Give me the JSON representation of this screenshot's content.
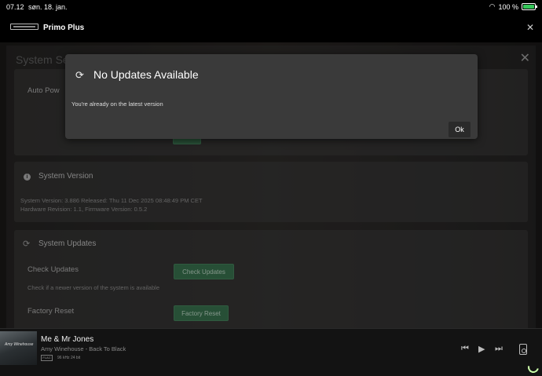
{
  "status_bar": {
    "time": "07.12",
    "date": "søn. 18. jan.",
    "battery": "100 %"
  },
  "app": {
    "title": "Primo Plus"
  },
  "page": {
    "title": "System Se",
    "auto_power_label": "Auto Pow",
    "version_card": {
      "title": "System Version",
      "line1": "System Version: 3.886 Released: Thu 11 Dec 2025 08:48:49 PM CET",
      "line2": "Hardware Revision: 1.1, Firmware Version: 0.5.2"
    },
    "updates_card": {
      "title": "System Updates",
      "check_label": "Check Updates",
      "check_desc": "Check if a newer version of the system is available",
      "check_button": "Check Updates",
      "factory_label": "Factory Reset",
      "factory_button": "Factory Reset"
    }
  },
  "dialog": {
    "title": "No Updates Available",
    "message": "You're already on the latest version",
    "ok_label": "Ok"
  },
  "player": {
    "track": "Me & Mr Jones",
    "artist_album": "Amy Winehouse - Back To Black",
    "format_badge": "FLAC",
    "spec": "96 kHz 24 bit",
    "cover_text": "Amy Winehouse"
  },
  "colors": {
    "accent_green": "#3c7a53",
    "battery_green": "#35c759"
  }
}
